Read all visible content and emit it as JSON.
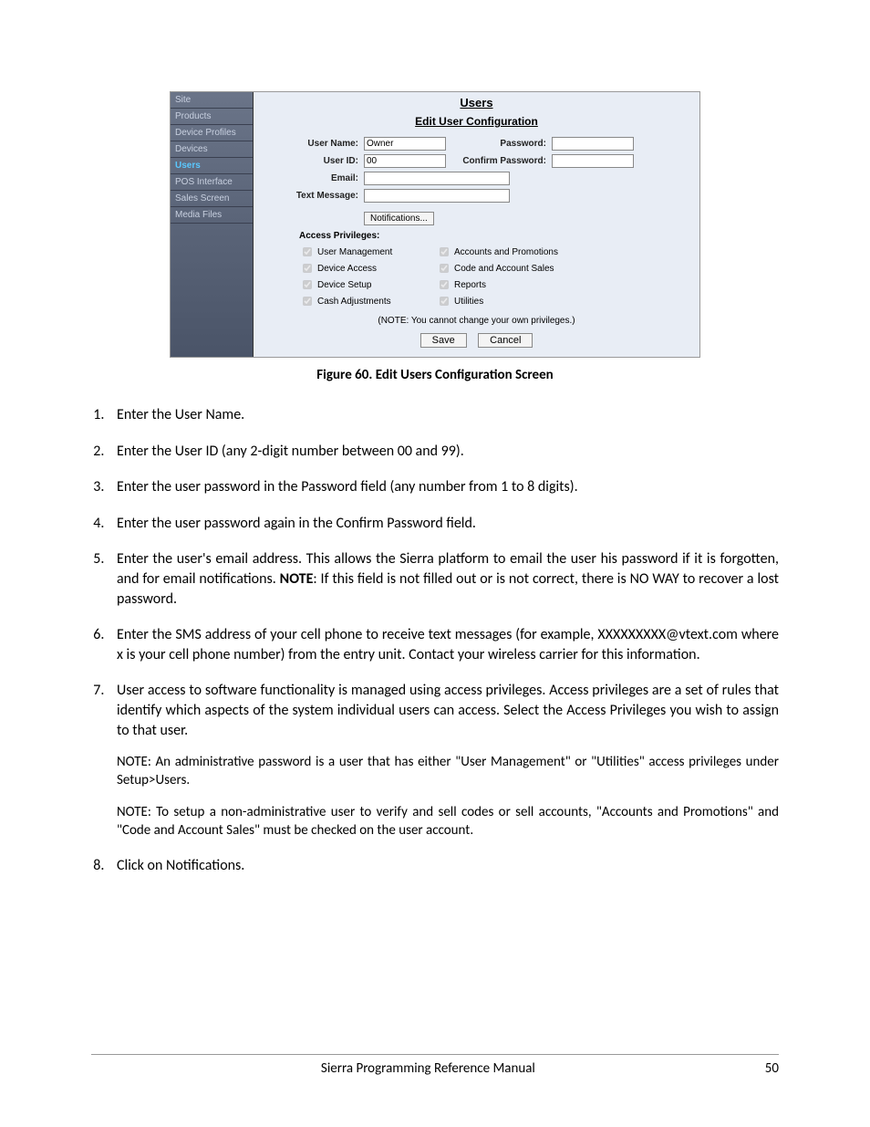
{
  "figure": {
    "caption": "Figure 60. Edit Users Configuration Screen",
    "sidebar": {
      "items": [
        "Site",
        "Products",
        "Device Profiles",
        "Devices",
        "Users",
        "POS Interface",
        "Sales Screen",
        "Media Files"
      ],
      "active_index": 4
    },
    "pane": {
      "title": "Users",
      "subtitle": "Edit User Configuration",
      "labels": {
        "username": "User Name:",
        "password": "Password:",
        "userid": "User ID:",
        "confirm": "Confirm Password:",
        "email": "Email:",
        "text": "Text Message:"
      },
      "values": {
        "username": "Owner",
        "userid": "00"
      },
      "notifications_btn": "Notifications...",
      "privs_title": "Access Privileges:",
      "privs_left": [
        "User Management",
        "Device Access",
        "Device Setup",
        "Cash Adjustments"
      ],
      "privs_right": [
        "Accounts and Promotions",
        "Code and Account Sales",
        "Reports",
        "Utilities"
      ],
      "note": "(NOTE: You cannot change your own privileges.)",
      "save": "Save",
      "cancel": "Cancel"
    }
  },
  "steps": {
    "s1": "Enter the User Name.",
    "s2": "Enter the User ID (any 2-digit number between 00 and 99).",
    "s3": "Enter the user password in the Password field (any number from 1 to 8 digits).",
    "s4": "Enter the user password again in the Confirm Password field.",
    "s5a": "Enter the user's email address. This allows the Sierra platform to email the user his password if it is forgotten, and for email notifications. ",
    "s5b": "NOTE",
    "s5c": ": If this field is not filled out or is not correct, there is NO WAY to recover a lost password.",
    "s6": "Enter the SMS address of your cell phone to receive text messages (for example, XXXXXXXXX@vtext.com where x is your cell phone number) from the entry unit. Contact your wireless carrier for this information.",
    "s7": "User access to software functionality is managed using access privileges. Access privileges are a set of rules that identify which aspects of the system individual users can access. Select the Access Privileges you wish to assign to that user.",
    "s7n1": "NOTE: An administrative password is a user that has either \"User Management\" or  \"Utilities\" access privileges under Setup>Users.",
    "s7n2": "NOTE: To setup a non-administrative user to verify and sell codes or sell accounts, \"Accounts and Promotions\" and \"Code and Account Sales\" must be checked on the user account.",
    "s8": "Click on Notifications."
  },
  "footer": {
    "title": "Sierra Programming Reference Manual",
    "page": "50"
  }
}
